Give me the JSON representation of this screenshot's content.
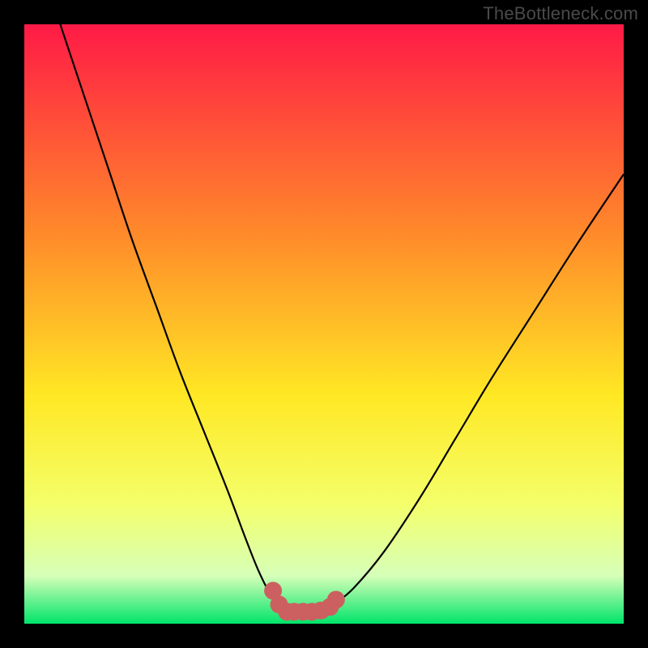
{
  "watermark": "TheBottleneck.com",
  "colors": {
    "frame": "#000000",
    "grad_top": "#ff1a46",
    "grad_mid1": "#ff8a2a",
    "grad_mid2": "#ffe824",
    "grad_mid3": "#f4ff6a",
    "grad_mid4": "#d6ffb8",
    "grad_bottom": "#00e46a",
    "curve": "#000000",
    "marker": "#cc6060"
  },
  "chart_data": {
    "type": "line",
    "title": "",
    "xlabel": "",
    "ylabel": "",
    "xlim": [
      0,
      100
    ],
    "ylim": [
      0,
      100
    ],
    "series": [
      {
        "name": "bottleneck-curve",
        "x": [
          6,
          10,
          14,
          18,
          22,
          26,
          30,
          34,
          37,
          39,
          41,
          42.5,
          44,
          46,
          48,
          50,
          52,
          55,
          60,
          66,
          72,
          78,
          85,
          92,
          100
        ],
        "y": [
          100,
          88,
          76,
          64,
          53,
          42,
          32,
          22,
          14,
          9,
          5,
          3,
          2,
          2,
          2,
          2.2,
          3.5,
          6,
          12,
          21,
          31,
          41,
          52,
          63,
          75
        ]
      }
    ],
    "markers": {
      "name": "highlighted-minimum",
      "x": [
        41.5,
        42.5,
        43.8,
        45,
        46.5,
        48,
        49.5,
        51,
        52
      ],
      "y": [
        5.5,
        3.2,
        2,
        2,
        2,
        2,
        2.2,
        2.8,
        4
      ]
    }
  }
}
